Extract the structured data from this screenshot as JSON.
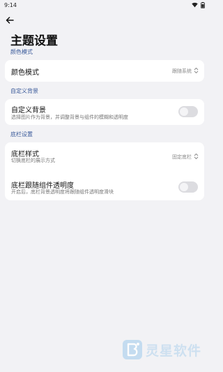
{
  "status_bar": {
    "time": "9:14"
  },
  "page": {
    "title": "主题设置"
  },
  "sections": {
    "color_mode": {
      "header": "颜色模式",
      "item_title": "颜色模式",
      "value": "跟随系统"
    },
    "custom_background": {
      "header": "自定义背景",
      "item_title": "自定义背景",
      "item_subtitle": "选择图片作为背景，并调整背景与组件的模糊和透明度",
      "toggle_on": false
    },
    "bottom_bar": {
      "header": "底栏设置",
      "style_title": "底栏样式",
      "style_subtitle": "切换底栏的展示方式",
      "style_value": "固定底栏",
      "follow_title": "底栏跟随组件透明度",
      "follow_subtitle": "开启后，底栏背景透明度将跟随组件透明度滑块",
      "follow_toggle_on": false
    }
  },
  "watermark": {
    "text": "灵星软件"
  },
  "colors": {
    "background": "#f2f2f5",
    "card": "#ffffff",
    "section_header": "#3a5a9a",
    "toggle_off": "#dcdce0"
  }
}
